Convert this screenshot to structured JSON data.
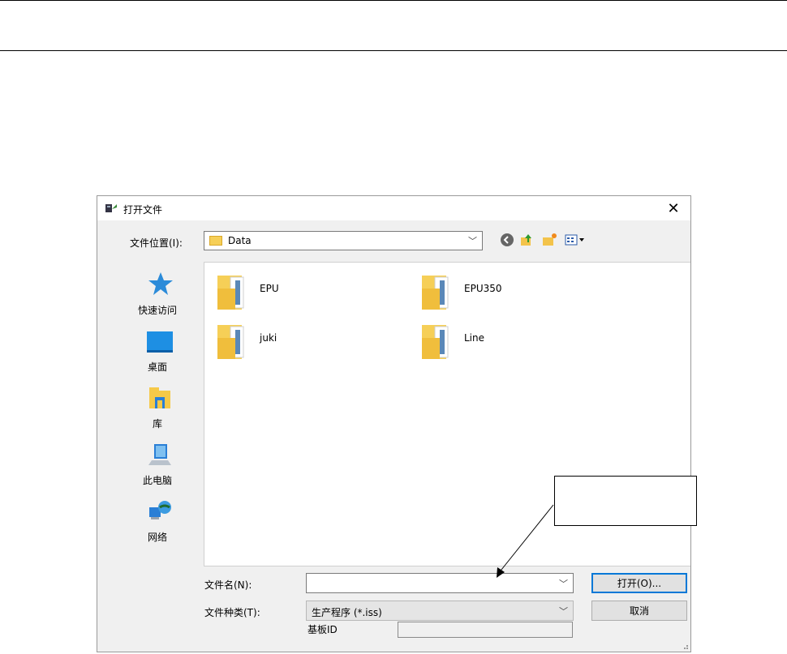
{
  "dialog": {
    "title": "打开文件",
    "look_in_label": "文件位置(I):",
    "look_in_value": "Data"
  },
  "places": [
    {
      "label": "快速访问",
      "icon": "quick-access-star-icon"
    },
    {
      "label": "桌面",
      "icon": "desktop-icon"
    },
    {
      "label": "库",
      "icon": "library-icon"
    },
    {
      "label": "此电脑",
      "icon": "this-pc-icon"
    },
    {
      "label": "网络",
      "icon": "network-icon"
    }
  ],
  "files": [
    {
      "name": "EPU"
    },
    {
      "name": "EPU350"
    },
    {
      "name": "juki"
    },
    {
      "name": "Line"
    }
  ],
  "form": {
    "filename_label": "文件名(N):",
    "filename_value": "",
    "filetype_label": "文件种类(T):",
    "filetype_value": "生产程序 (*.iss)",
    "board_id_label": "基板ID",
    "board_id_value": ""
  },
  "buttons": {
    "open": "打开(O)...",
    "cancel": "取消"
  },
  "callout": {
    "text": ""
  }
}
